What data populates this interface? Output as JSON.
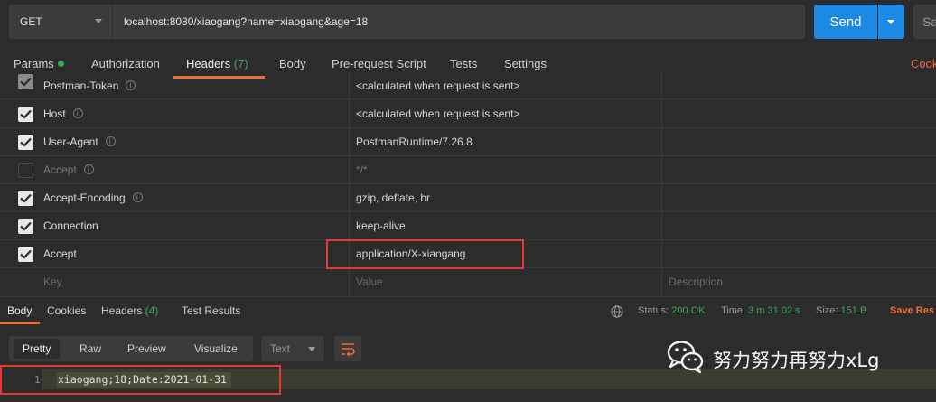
{
  "request": {
    "method": "GET",
    "url": "localhost:8080/xiaogang?name=xiaogang&age=18",
    "send_label": "Send",
    "save_label": "Sa"
  },
  "request_tabs": {
    "params": "Params",
    "authorization": "Authorization",
    "headers": "Headers",
    "headers_count": "(7)",
    "body": "Body",
    "prerequest": "Pre-request Script",
    "tests": "Tests",
    "settings": "Settings",
    "cookies": "Cook"
  },
  "headers": [
    {
      "key": "Postman-Token",
      "value": "<calculated when request is sent>",
      "checked": true,
      "dim": false
    },
    {
      "key": "Host",
      "value": "<calculated when request is sent>",
      "checked": true,
      "dim": false
    },
    {
      "key": "User-Agent",
      "value": "PostmanRuntime/7.26.8",
      "checked": true,
      "dim": false
    },
    {
      "key": "Accept",
      "value": "*/*",
      "checked": false,
      "dim": true
    },
    {
      "key": "Accept-Encoding",
      "value": "gzip, deflate, br",
      "checked": true,
      "dim": false
    },
    {
      "key": "Connection",
      "value": "keep-alive",
      "checked": true,
      "dim": false
    },
    {
      "key": "Accept",
      "value": "application/X-xiaogang",
      "checked": true,
      "dim": false
    }
  ],
  "new_row": {
    "key": "Key",
    "value": "Value",
    "description": "Description"
  },
  "response_tabs": {
    "body": "Body",
    "cookies": "Cookies",
    "headers": "Headers",
    "headers_count": "(4)",
    "test_results": "Test Results"
  },
  "response_status": {
    "status_label": "Status:",
    "status_value": "200 OK",
    "time_label": "Time:",
    "time_value": "3 m 31.02 s",
    "size_label": "Size:",
    "size_value": "151 B",
    "save_response": "Save Res"
  },
  "view": {
    "pretty": "Pretty",
    "raw": "Raw",
    "preview": "Preview",
    "visualize": "Visualize",
    "format": "Text"
  },
  "code": {
    "line_number": "1",
    "content": "xiaogang;18;Date:2021-01-31"
  },
  "watermark": "努力努力再努力xLg",
  "colors": {
    "accent": "#f26b3a",
    "send": "#1e88e5",
    "ok": "#3fa55b",
    "highlight_box": "#e53935"
  }
}
